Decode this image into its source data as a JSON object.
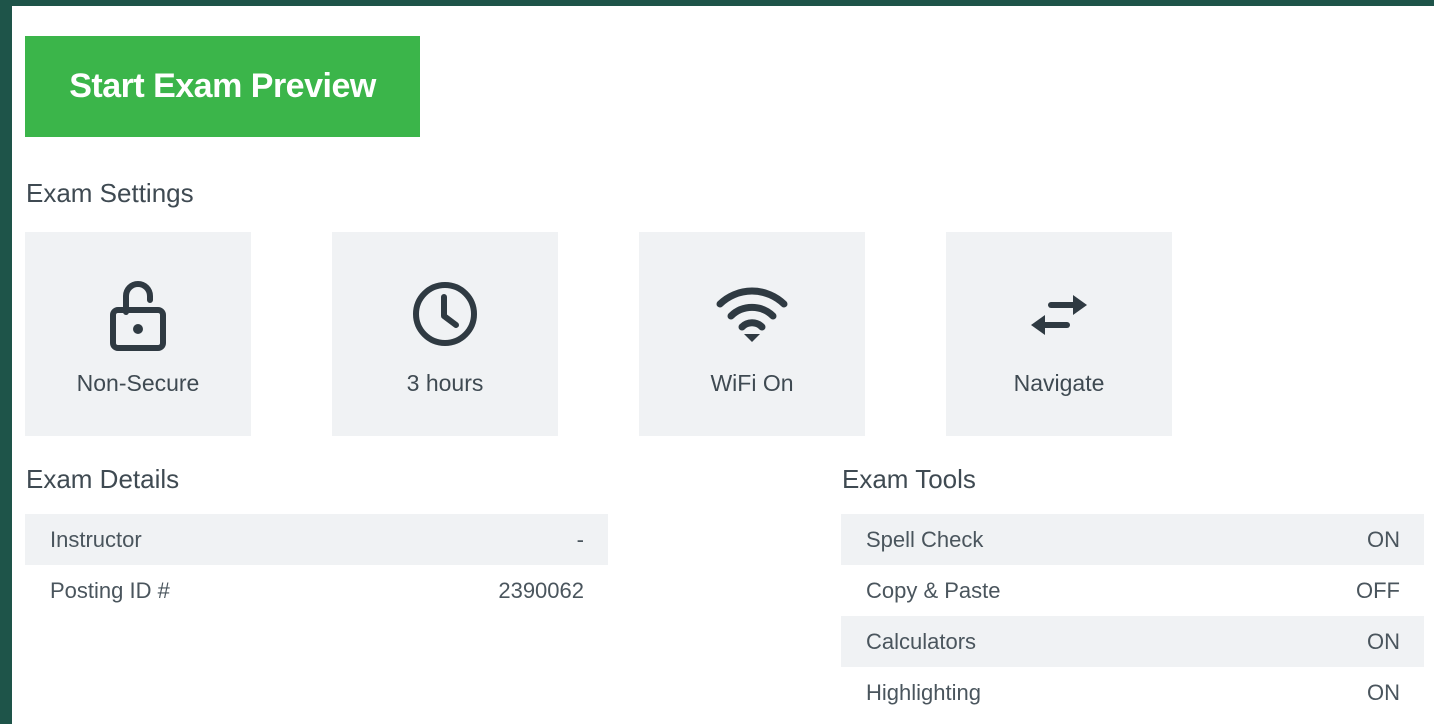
{
  "start_button": {
    "label": "Start Exam Preview"
  },
  "exam_settings": {
    "title": "Exam Settings",
    "tiles": [
      {
        "icon": "lock-open-icon",
        "label": "Non-Secure"
      },
      {
        "icon": "clock-icon",
        "label": "3 hours"
      },
      {
        "icon": "wifi-icon",
        "label": "WiFi On"
      },
      {
        "icon": "arrows-swap-icon",
        "label": "Navigate"
      }
    ]
  },
  "exam_details": {
    "title": "Exam Details",
    "rows": [
      {
        "label": "Instructor",
        "value": "-"
      },
      {
        "label": "Posting ID #",
        "value": "2390062"
      }
    ]
  },
  "exam_tools": {
    "title": "Exam Tools",
    "rows": [
      {
        "label": "Spell Check",
        "value": "ON"
      },
      {
        "label": "Copy & Paste",
        "value": "OFF"
      },
      {
        "label": "Calculators",
        "value": "ON"
      },
      {
        "label": "Highlighting",
        "value": "ON"
      }
    ]
  },
  "colors": {
    "accent_green": "#3bb54a",
    "frame": "#1e5449",
    "tile_bg": "#f0f2f4",
    "icon": "#2f3a42"
  }
}
